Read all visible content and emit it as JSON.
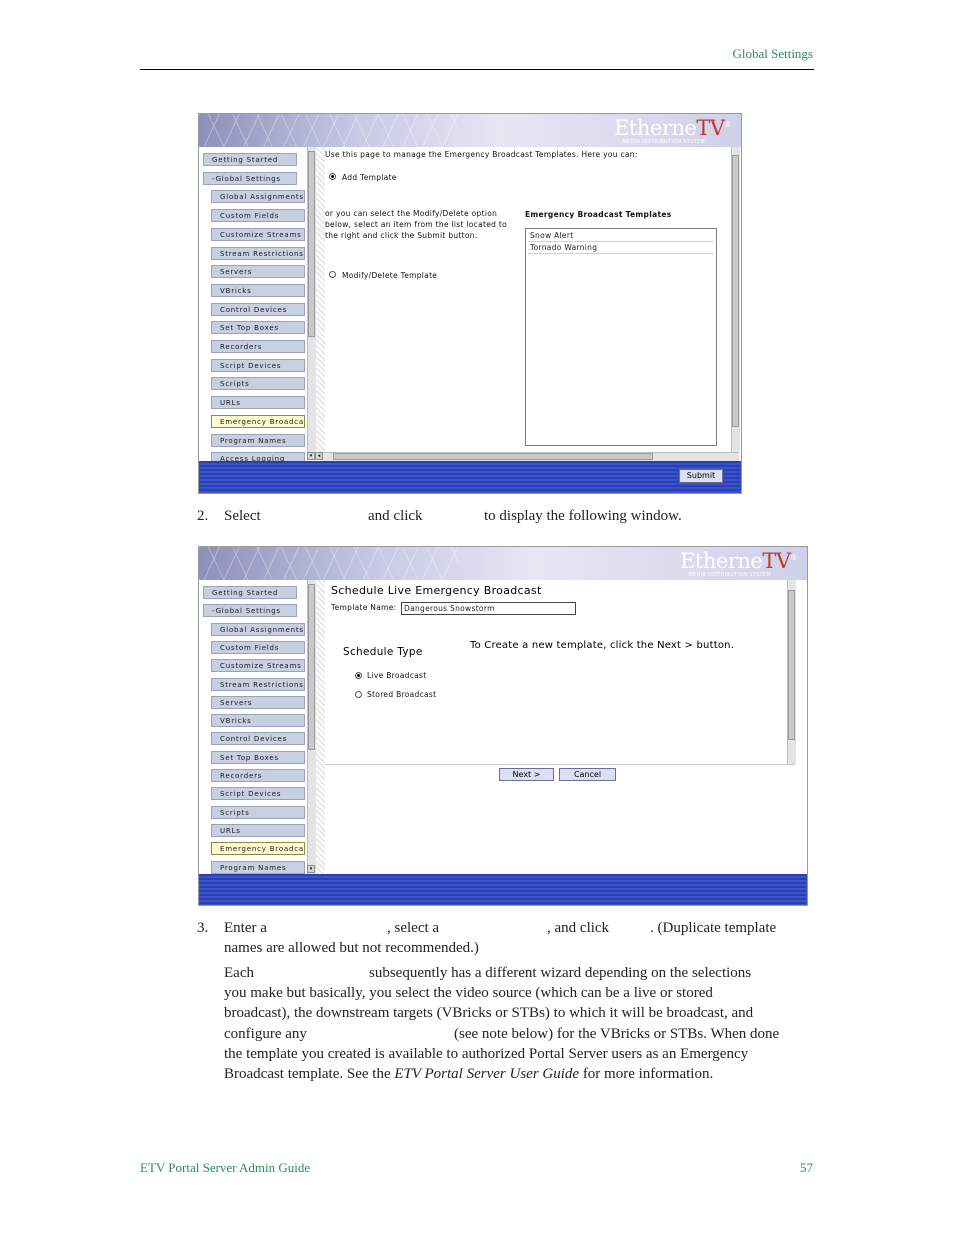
{
  "running_head": "Global Settings",
  "footer": {
    "left": "ETV Portal Server Admin Guide",
    "right": "57"
  },
  "logo": {
    "main": "Etherne",
    "accent": "TV",
    "reg": "®",
    "tagline": "MEDIA DISTRIBUTION SYSTEM"
  },
  "sidebar1": {
    "top_items": [
      "Getting Started",
      "-Global Settings"
    ],
    "sub_items": [
      "Global Assignments",
      "Custom Fields",
      "Customize Streams",
      "Stream Restrictions",
      "Servers",
      "VBricks",
      "Control Devices",
      "Set Top Boxes",
      "Recorders",
      "Script Devices",
      "Scripts",
      "URLs",
      "Emergency Broadcast",
      "Program Names",
      "Access Logging"
    ]
  },
  "sidebar2": {
    "top_items": [
      "Getting Started",
      "-Global Settings"
    ],
    "sub_items": [
      "Global Assignments",
      "Custom Fields",
      "Customize Streams",
      "Stream Restrictions",
      "Servers",
      "VBricks",
      "Control Devices",
      "Set Top Boxes",
      "Recorders",
      "Script Devices",
      "Scripts",
      "URLs",
      "Emergency Broadcast",
      "Program Names"
    ]
  },
  "screen1": {
    "intro": "Use this page to manage the Emergency Broadcast Templates. Here you can:",
    "add_template": "Add Template",
    "or_text": [
      "or you can select the Modify/Delete option",
      "below, select an item from the list located to",
      "the right and click the Submit button."
    ],
    "modify_delete": "Modify/Delete Template",
    "list_heading": "Emergency Broadcast Templates",
    "templates": [
      "Snow Alert",
      "Tornado Warning"
    ],
    "submit": "Submit"
  },
  "step2": {
    "number": "2.",
    "a": "Select",
    "b": "and click",
    "c": "to display the following window."
  },
  "screen2": {
    "title": "Schedule Live Emergency Broadcast",
    "name_label": "Template Name:",
    "name_value": "Dangerous Snowstorm",
    "schedule_type": "Schedule Type",
    "instruction": "To Create a new template, click the Next > button.",
    "options": [
      "Live Broadcast",
      "Stored Broadcast"
    ],
    "next": "Next >",
    "cancel": "Cancel"
  },
  "step3": {
    "number": "3.",
    "a": "Enter a",
    "b": ", select a",
    "c": ", and click",
    "d": ". (Duplicate template",
    "line2": "names are allowed but not recommended.)"
  },
  "para": {
    "l1a": "Each",
    "l1b": "subsequently has a different wizard depending on the selections",
    "l2": "you make but basically, you select the video source (which can be a live or stored",
    "l3": "broadcast), the downstream targets (VBricks or STBs) to which it will be broadcast, and",
    "l4a": "configure any",
    "l4b": "(see note below) for the VBricks or STBs. When done",
    "l5": "the template you created is available to authorized Portal Server users as an Emergency",
    "l6a": "Broadcast template. See the",
    "l6b": "ETV Portal Server User Guide",
    "l6c": "for more information."
  }
}
